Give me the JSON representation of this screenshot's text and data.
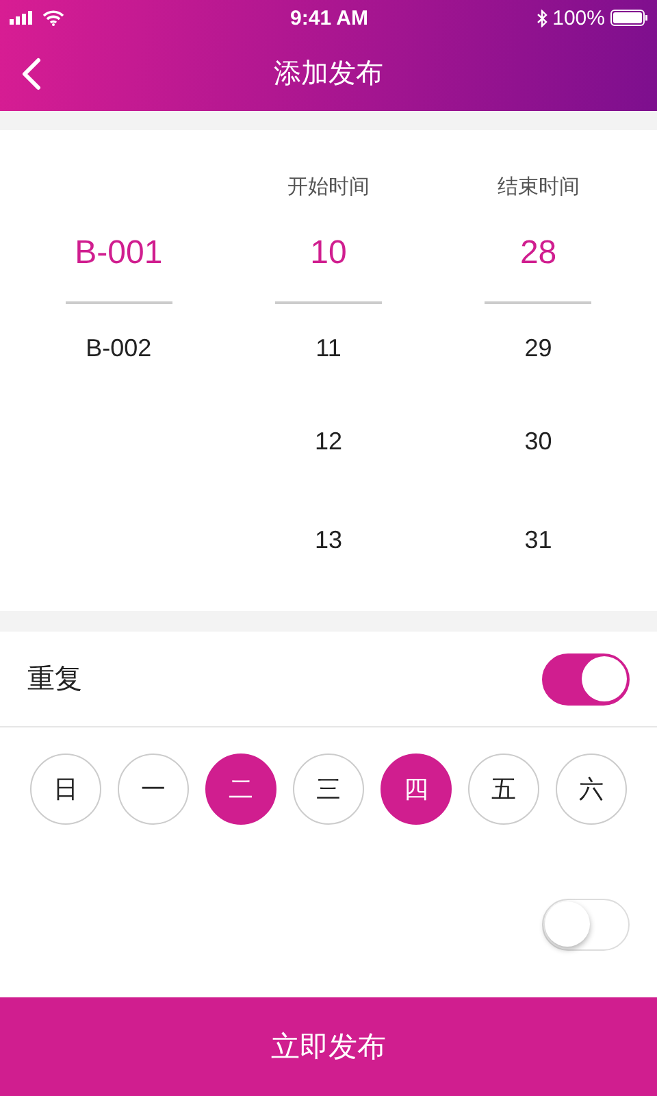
{
  "status_bar": {
    "time": "9:41 AM",
    "battery": "100%"
  },
  "nav": {
    "title": "添加发布"
  },
  "picker": {
    "columns": [
      {
        "items": [
          {
            "text": "B-001",
            "selected": true
          },
          {
            "text": "B-002",
            "selected": false
          }
        ]
      },
      {
        "header": "开始时间",
        "items": [
          {
            "text": "10",
            "selected": true
          },
          {
            "text": "11",
            "selected": false
          },
          {
            "text": "12",
            "selected": false
          },
          {
            "text": "13",
            "selected": false
          }
        ]
      },
      {
        "header": "结束时间",
        "items": [
          {
            "text": "28",
            "selected": true
          },
          {
            "text": "29",
            "selected": false
          },
          {
            "text": "30",
            "selected": false
          },
          {
            "text": "31",
            "selected": false
          }
        ]
      }
    ]
  },
  "repeat": {
    "label": "重复",
    "on": true
  },
  "days": [
    {
      "label": "日",
      "selected": false
    },
    {
      "label": "一",
      "selected": false
    },
    {
      "label": "二",
      "selected": true
    },
    {
      "label": "三",
      "selected": false
    },
    {
      "label": "四",
      "selected": true
    },
    {
      "label": "五",
      "selected": false
    },
    {
      "label": "六",
      "selected": false
    }
  ],
  "second_toggle": {
    "on": false
  },
  "submit_button": "立即发布"
}
